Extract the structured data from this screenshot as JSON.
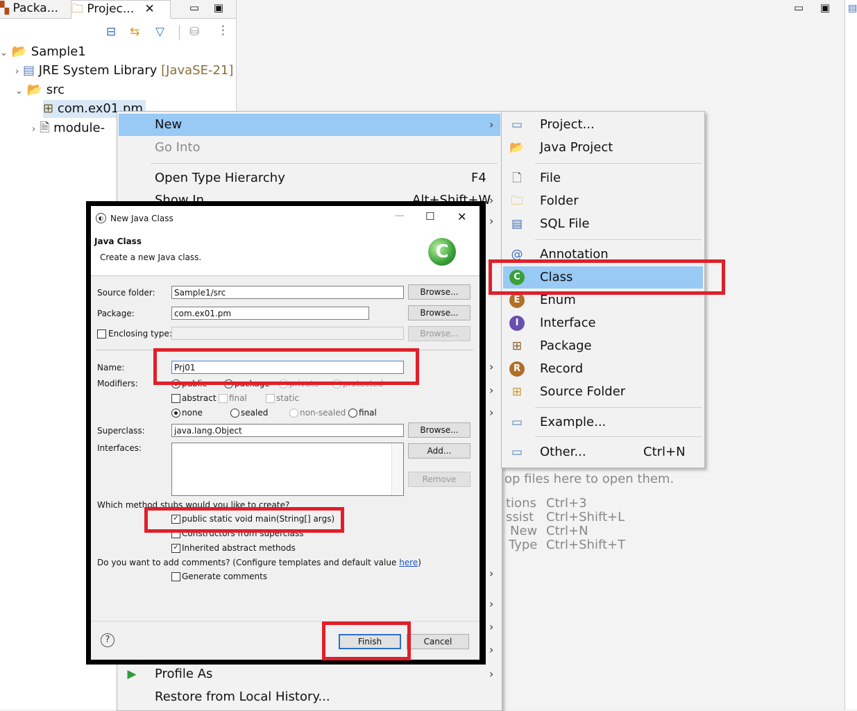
{
  "explorer": {
    "tabs": [
      {
        "label": "Packa..."
      },
      {
        "label": "Projec..."
      }
    ],
    "tree": {
      "project": "Sample1",
      "jre": "JRE System Library",
      "jre_version": "[JavaSE-21]",
      "src": "src",
      "package": "com.ex01.pm",
      "module": "module-"
    }
  },
  "context_menu": {
    "items": [
      {
        "label": "New"
      },
      {
        "label": "Go Into"
      },
      {
        "label": "Open Type Hierarchy",
        "shortcut": "F4"
      },
      {
        "label": "Show In",
        "shortcut": "Alt+Shift+W"
      },
      {
        "label": "Profile As"
      },
      {
        "label": "Restore from Local History..."
      }
    ]
  },
  "new_submenu": {
    "items": [
      {
        "label": "Project...",
        "icon": "project-icon"
      },
      {
        "label": "Java Project",
        "icon": "java-project-icon"
      },
      {
        "label": "File",
        "icon": "file-icon"
      },
      {
        "label": "Folder",
        "icon": "folder-icon"
      },
      {
        "label": "SQL File",
        "icon": "sql-file-icon"
      },
      {
        "label": "Annotation",
        "icon": "annotation-icon"
      },
      {
        "label": "Class",
        "icon": "class-icon"
      },
      {
        "label": "Enum",
        "icon": "enum-icon"
      },
      {
        "label": "Interface",
        "icon": "interface-icon"
      },
      {
        "label": "Package",
        "icon": "package-icon"
      },
      {
        "label": "Record",
        "icon": "record-icon"
      },
      {
        "label": "Source Folder",
        "icon": "source-folder-icon"
      },
      {
        "label": "Example...",
        "icon": "example-icon"
      },
      {
        "label": "Other...",
        "shortcut": "Ctrl+N",
        "icon": "other-icon"
      }
    ]
  },
  "editor_hints": {
    "drop": "op files here to open them.",
    "rows": [
      {
        "label": "tions",
        "shortcut": "Ctrl+3"
      },
      {
        "label": "ssist",
        "shortcut": "Ctrl+Shift+L"
      },
      {
        "label": "New",
        "shortcut": "Ctrl+N"
      },
      {
        "label": "Type",
        "shortcut": "Ctrl+Shift+T"
      }
    ]
  },
  "dialog": {
    "title": "New Java Class",
    "heading": "Java Class",
    "description": "Create a new Java class.",
    "source_folder_label": "Source folder:",
    "source_folder_value": "Sample1/src",
    "package_label": "Package:",
    "package_value": "com.ex01.pm",
    "enclosing_label": "Enclosing type:",
    "browse_label": "Browse...",
    "name_label": "Name:",
    "name_value": "Prj01",
    "modifiers_label": "Modifiers:",
    "access": [
      "public",
      "package",
      "private",
      "protected"
    ],
    "abstract_label": "abstract",
    "final_label": "final",
    "static_label": "static",
    "none_label": "none",
    "sealed_label": "sealed",
    "non_sealed_label": "non-sealed",
    "final2_label": "final",
    "superclass_label": "Superclass:",
    "superclass_value": "java.lang.Object",
    "interfaces_label": "Interfaces:",
    "add_label": "Add...",
    "remove_label": "Remove",
    "stubs_question": "Which method stubs would you like to create?",
    "stub_main": "public static void main(String[] args)",
    "stub_constructors": "Constructors from superclass",
    "stub_inherited": "Inherited abstract methods",
    "comments_question": "Do you want to add comments? (Configure templates and default value ",
    "comments_link": "here",
    "comments_close": ")",
    "generate_comments": "Generate comments",
    "finish_label": "Finish",
    "cancel_label": "Cancel",
    "help_label": "?"
  },
  "colors": {
    "highlight": "#99c9f5",
    "annotation_red": "#e0202a"
  }
}
